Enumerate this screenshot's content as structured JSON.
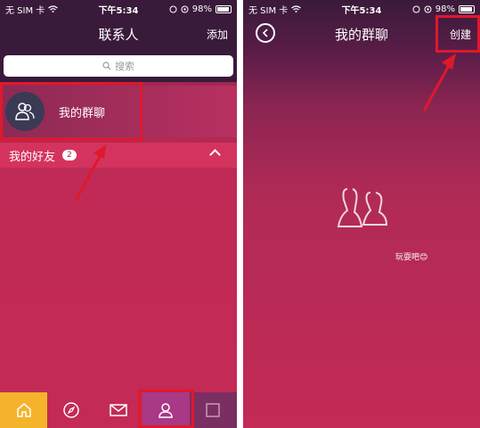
{
  "left": {
    "status": {
      "carrier": "无 SIM 卡",
      "time": "下午5:34",
      "battery": "98%"
    },
    "nav": {
      "title": "联系人",
      "action": "添加"
    },
    "search": {
      "placeholder": "搜索"
    },
    "group": {
      "label": "我的群聊"
    },
    "friends": {
      "label": "我的好友",
      "count": "2"
    },
    "tabs": [
      {
        "name": "home",
        "icon": "home-icon"
      },
      {
        "name": "discover",
        "icon": "compass-icon"
      },
      {
        "name": "messages",
        "icon": "mail-icon"
      },
      {
        "name": "contacts",
        "icon": "person-icon"
      },
      {
        "name": "more",
        "icon": "square-icon"
      }
    ]
  },
  "right": {
    "status": {
      "carrier": "无 SIM 卡",
      "time": "下午5:34",
      "battery": "98%"
    },
    "nav": {
      "title": "我的群聊",
      "action": "创建"
    },
    "empty": {
      "text": "玩耍吧😊"
    }
  },
  "colors": {
    "accent": "#c42a56",
    "highlight": "#e0182c",
    "home_tab": "#f4b32a"
  }
}
